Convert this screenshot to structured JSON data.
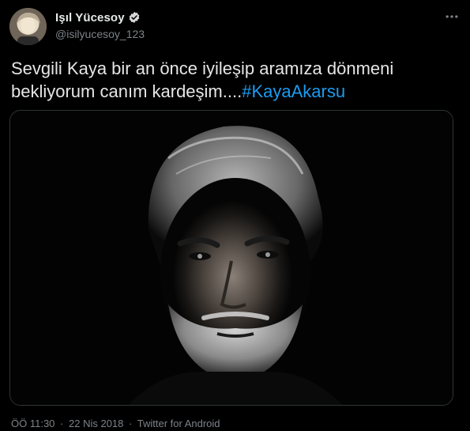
{
  "author": {
    "display_name": "Işıl Yücesoy",
    "handle": "@isilyucesoy_123",
    "verified_icon": "verified-badge-icon",
    "avatar_icon": "avatar"
  },
  "more_icon": "more-options-icon",
  "tweet": {
    "text": "Sevgili Kaya bir an önce iyileşip aramıza dönmeni bekliyorum canım kardeşim....",
    "hashtag": "#KayaAkarsu"
  },
  "media": {
    "kind": "photo"
  },
  "meta": {
    "time": "ÖÖ 11:30",
    "separator": "·",
    "date": "22 Nis 2018",
    "source": "Twitter for Android"
  },
  "colors": {
    "background": "#000000",
    "text": "#e6e6e6",
    "muted": "#7d8287",
    "link": "#1d9bf0",
    "verified": "#d9d9d9"
  }
}
